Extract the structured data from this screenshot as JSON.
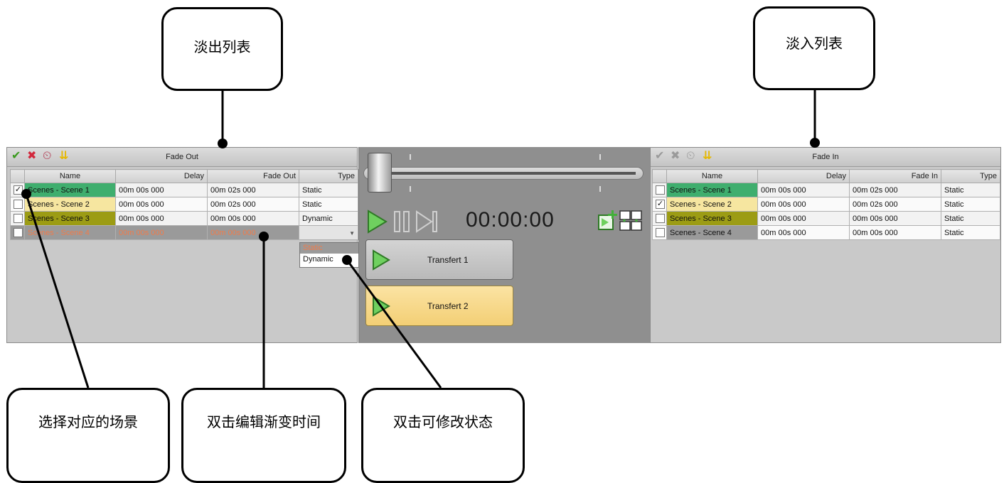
{
  "callouts": {
    "fade_out_list": "淡出列表",
    "fade_in_list": "淡入列表",
    "select_scene": "选择对应的场景",
    "edit_fade_time": "双击编辑渐变时间",
    "edit_state": "双击可修改状态"
  },
  "fade_out_panel": {
    "title": "Fade Out",
    "columns": [
      "Name",
      "Delay",
      "Fade Out",
      "Type"
    ],
    "rows": [
      {
        "checked": true,
        "name": "Scenes - Scene 1",
        "delay": "00m 00s 000",
        "fade": "00m 02s 000",
        "type": "Static"
      },
      {
        "checked": false,
        "name": "Scenes - Scene 2",
        "delay": "00m 00s 000",
        "fade": "00m 02s 000",
        "type": "Static"
      },
      {
        "checked": false,
        "name": "Scenes - Scene 3",
        "delay": "00m 00s 000",
        "fade": "00m 00s 000",
        "type": "Dynamic"
      },
      {
        "checked": false,
        "name": "Scenes - Scene 4",
        "delay": "00m 00s 000",
        "fade": "00m 00s 000",
        "type": ""
      }
    ],
    "type_options": [
      "Static",
      "Dynamic"
    ]
  },
  "fade_in_panel": {
    "title": "Fade In",
    "columns": [
      "Name",
      "Delay",
      "Fade In",
      "Type"
    ],
    "rows": [
      {
        "checked": false,
        "name": "Scenes - Scene 1",
        "delay": "00m 00s 000",
        "fade": "00m 02s 000",
        "type": "Static"
      },
      {
        "checked": true,
        "name": "Scenes - Scene 2",
        "delay": "00m 00s 000",
        "fade": "00m 02s 000",
        "type": "Static"
      },
      {
        "checked": false,
        "name": "Scenes - Scene 3",
        "delay": "00m 00s 000",
        "fade": "00m 00s 000",
        "type": "Static"
      },
      {
        "checked": false,
        "name": "Scenes - Scene 4",
        "delay": "00m 00s 000",
        "fade": "00m 00s 000",
        "type": "Static"
      }
    ]
  },
  "transport": {
    "time": "00:00:00",
    "transfer1": "Transfert 1",
    "transfer2": "Transfert 2"
  },
  "colors": {
    "scene1": "#3fae6e",
    "scene2": "#f6e6a0",
    "scene3": "#9c9c14",
    "transfer_active": "#f8d98a",
    "play_green": "#5dc24f"
  }
}
